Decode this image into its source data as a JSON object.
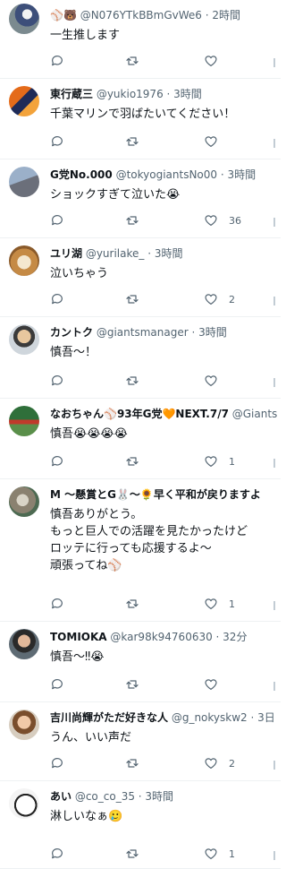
{
  "tweets": [
    {
      "name": "",
      "handle": "⚾🐻 @N076YTkBBmGvWe6 · 2時間",
      "lines": [
        "一生推します"
      ],
      "reply_count": "",
      "retweet_count": "",
      "like_count": "",
      "avatar_icon": "baseball-player-photo"
    },
    {
      "name": "東行蔵三",
      "handle": "@yukio1976 · 3時間",
      "lines": [
        "千葉マリンで羽ばたいてください！"
      ],
      "reply_count": "",
      "retweet_count": "",
      "like_count": "",
      "avatar_icon": "team-jersey-photo"
    },
    {
      "name": "G党No.000",
      "handle": "@tokyogiantsNo00 · 3時間",
      "lines": [
        "ショックすぎて泣いた😭"
      ],
      "reply_count": "",
      "retweet_count": "",
      "like_count": "36",
      "avatar_icon": "batter-photo"
    },
    {
      "name": "ユリ湖",
      "handle": "@yurilake_ · 3時間",
      "lines": [
        "泣いちゃう"
      ],
      "reply_count": "",
      "retweet_count": "",
      "like_count": "2",
      "avatar_icon": "food-photo"
    },
    {
      "name": "カントク",
      "handle": "@giantsmanager · 3時間",
      "lines": [
        "慎吾～！"
      ],
      "reply_count": "",
      "retweet_count": "",
      "like_count": "",
      "avatar_icon": "manager-photo"
    },
    {
      "name": "なおちゃん⚾93年G党🧡NEXT.7/7",
      "handle": "@Giants",
      "lines": [
        "慎吾😭😭😭😭"
      ],
      "reply_count": "",
      "retweet_count": "",
      "like_count": "1",
      "avatar_icon": "stadium-photo"
    },
    {
      "name": "M ～懸賞とG🐰～🌻早く平和が戻りますよ",
      "handle": "",
      "lines": [
        "慎吾ありがとう。",
        "もっと巨人での活躍を見たかったけど",
        "ロッテに行っても応援するよ～",
        "頑張ってね⚾"
      ],
      "reply_count": "",
      "retweet_count": "",
      "like_count": "1",
      "avatar_icon": "wolf-photo"
    },
    {
      "name": "TOMIOKA",
      "handle": "@kar98k94760630 · 32分",
      "lines": [
        "慎吾～‼😭"
      ],
      "reply_count": "",
      "retweet_count": "",
      "like_count": "",
      "avatar_icon": "person-photo"
    },
    {
      "name": "吉川尚輝がただ好きな人",
      "handle": "@g_nokyskw2 · 3日",
      "lines": [
        "うん、いい声だ"
      ],
      "reply_count": "",
      "retweet_count": "",
      "like_count": "2",
      "avatar_icon": "player-portrait-photo"
    },
    {
      "name": "あい",
      "handle": "@co_co_35 · 3時間",
      "lines": [
        "淋しいなぁ🥲"
      ],
      "reply_count": "",
      "retweet_count": "",
      "like_count": "1",
      "avatar_icon": "dog-photo"
    }
  ]
}
